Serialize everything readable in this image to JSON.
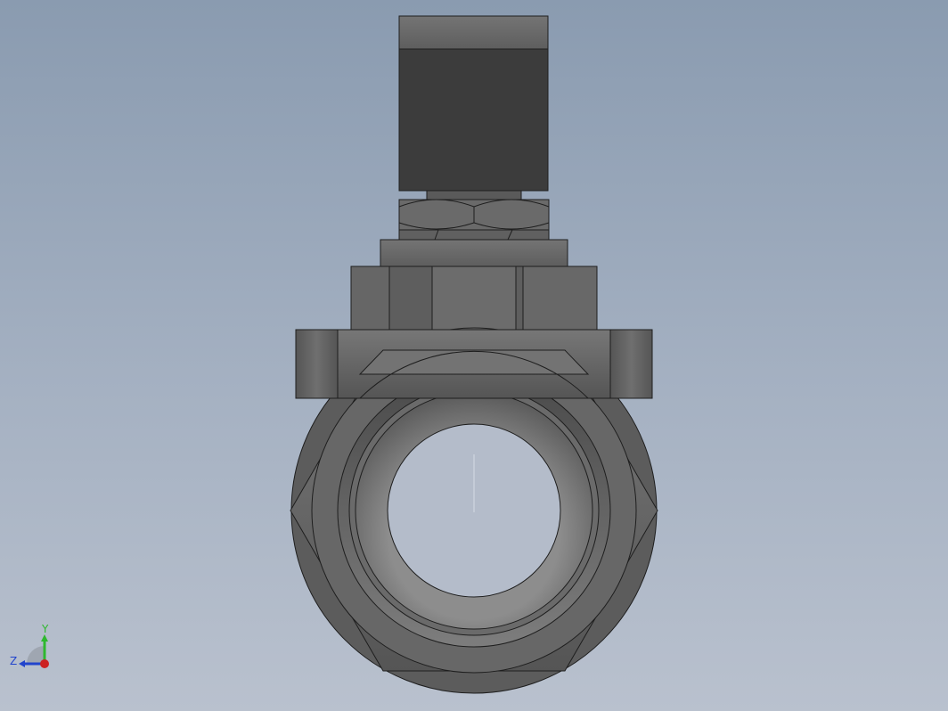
{
  "viewport": {
    "background_top": "#8a9bb0",
    "background_bottom": "#b9c1ce"
  },
  "model": {
    "part_color": "#6e6e6e",
    "coil_color": "#3c3c3c",
    "edge_color": "#1e1e1e",
    "bore_color": "#b4bcca"
  },
  "triad": {
    "y_label": "Y",
    "z_label": "Z",
    "y_color": "#2fb82f",
    "z_color": "#2244cc",
    "x_color": "#cc2222",
    "y_icon": "y-axis-arrow-icon",
    "z_icon": "z-axis-arrow-icon",
    "origin_icon": "x-axis-origin-icon"
  }
}
